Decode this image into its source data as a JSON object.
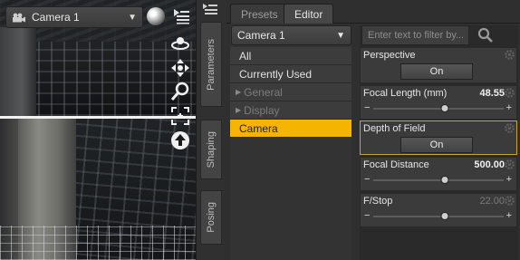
{
  "viewport": {
    "camera_label": "Camera 1",
    "icons": [
      "camera-icon",
      "chevron-down-icon",
      "preview-sphere-icon",
      "viewport-menu-icon",
      "orbit-icon",
      "pan-icon",
      "zoom-icon",
      "frame-icon",
      "reset-icon"
    ]
  },
  "side_tabs": {
    "parameters": "Parameters",
    "shaping": "Shaping",
    "posing": "Posing"
  },
  "tabs": {
    "presets": "Presets",
    "editor": "Editor",
    "active": "Editor"
  },
  "groups": {
    "selected_node": "Camera 1",
    "items": [
      {
        "label": "All"
      },
      {
        "label": "Currently Used"
      },
      {
        "label": "General"
      },
      {
        "label": "Display"
      },
      {
        "label": "Camera"
      }
    ],
    "selected": "Camera"
  },
  "filter": {
    "placeholder": "Enter text to filter by..."
  },
  "properties": {
    "perspective": {
      "label": "Perspective",
      "value": "On"
    },
    "focal_length": {
      "label": "Focal Length (mm)",
      "value": "48.55",
      "slider_fraction": 0.55
    },
    "depth_of_field": {
      "label": "Depth of Field",
      "value": "On"
    },
    "focal_distance": {
      "label": "Focal Distance",
      "value": "500.00",
      "slider_fraction": 0.55
    },
    "fstop": {
      "label": "F/Stop",
      "value": "22.00",
      "slider_fraction": 0.55
    }
  },
  "colors": {
    "selection": "#f5b400",
    "highlight_border": "#caa230"
  }
}
